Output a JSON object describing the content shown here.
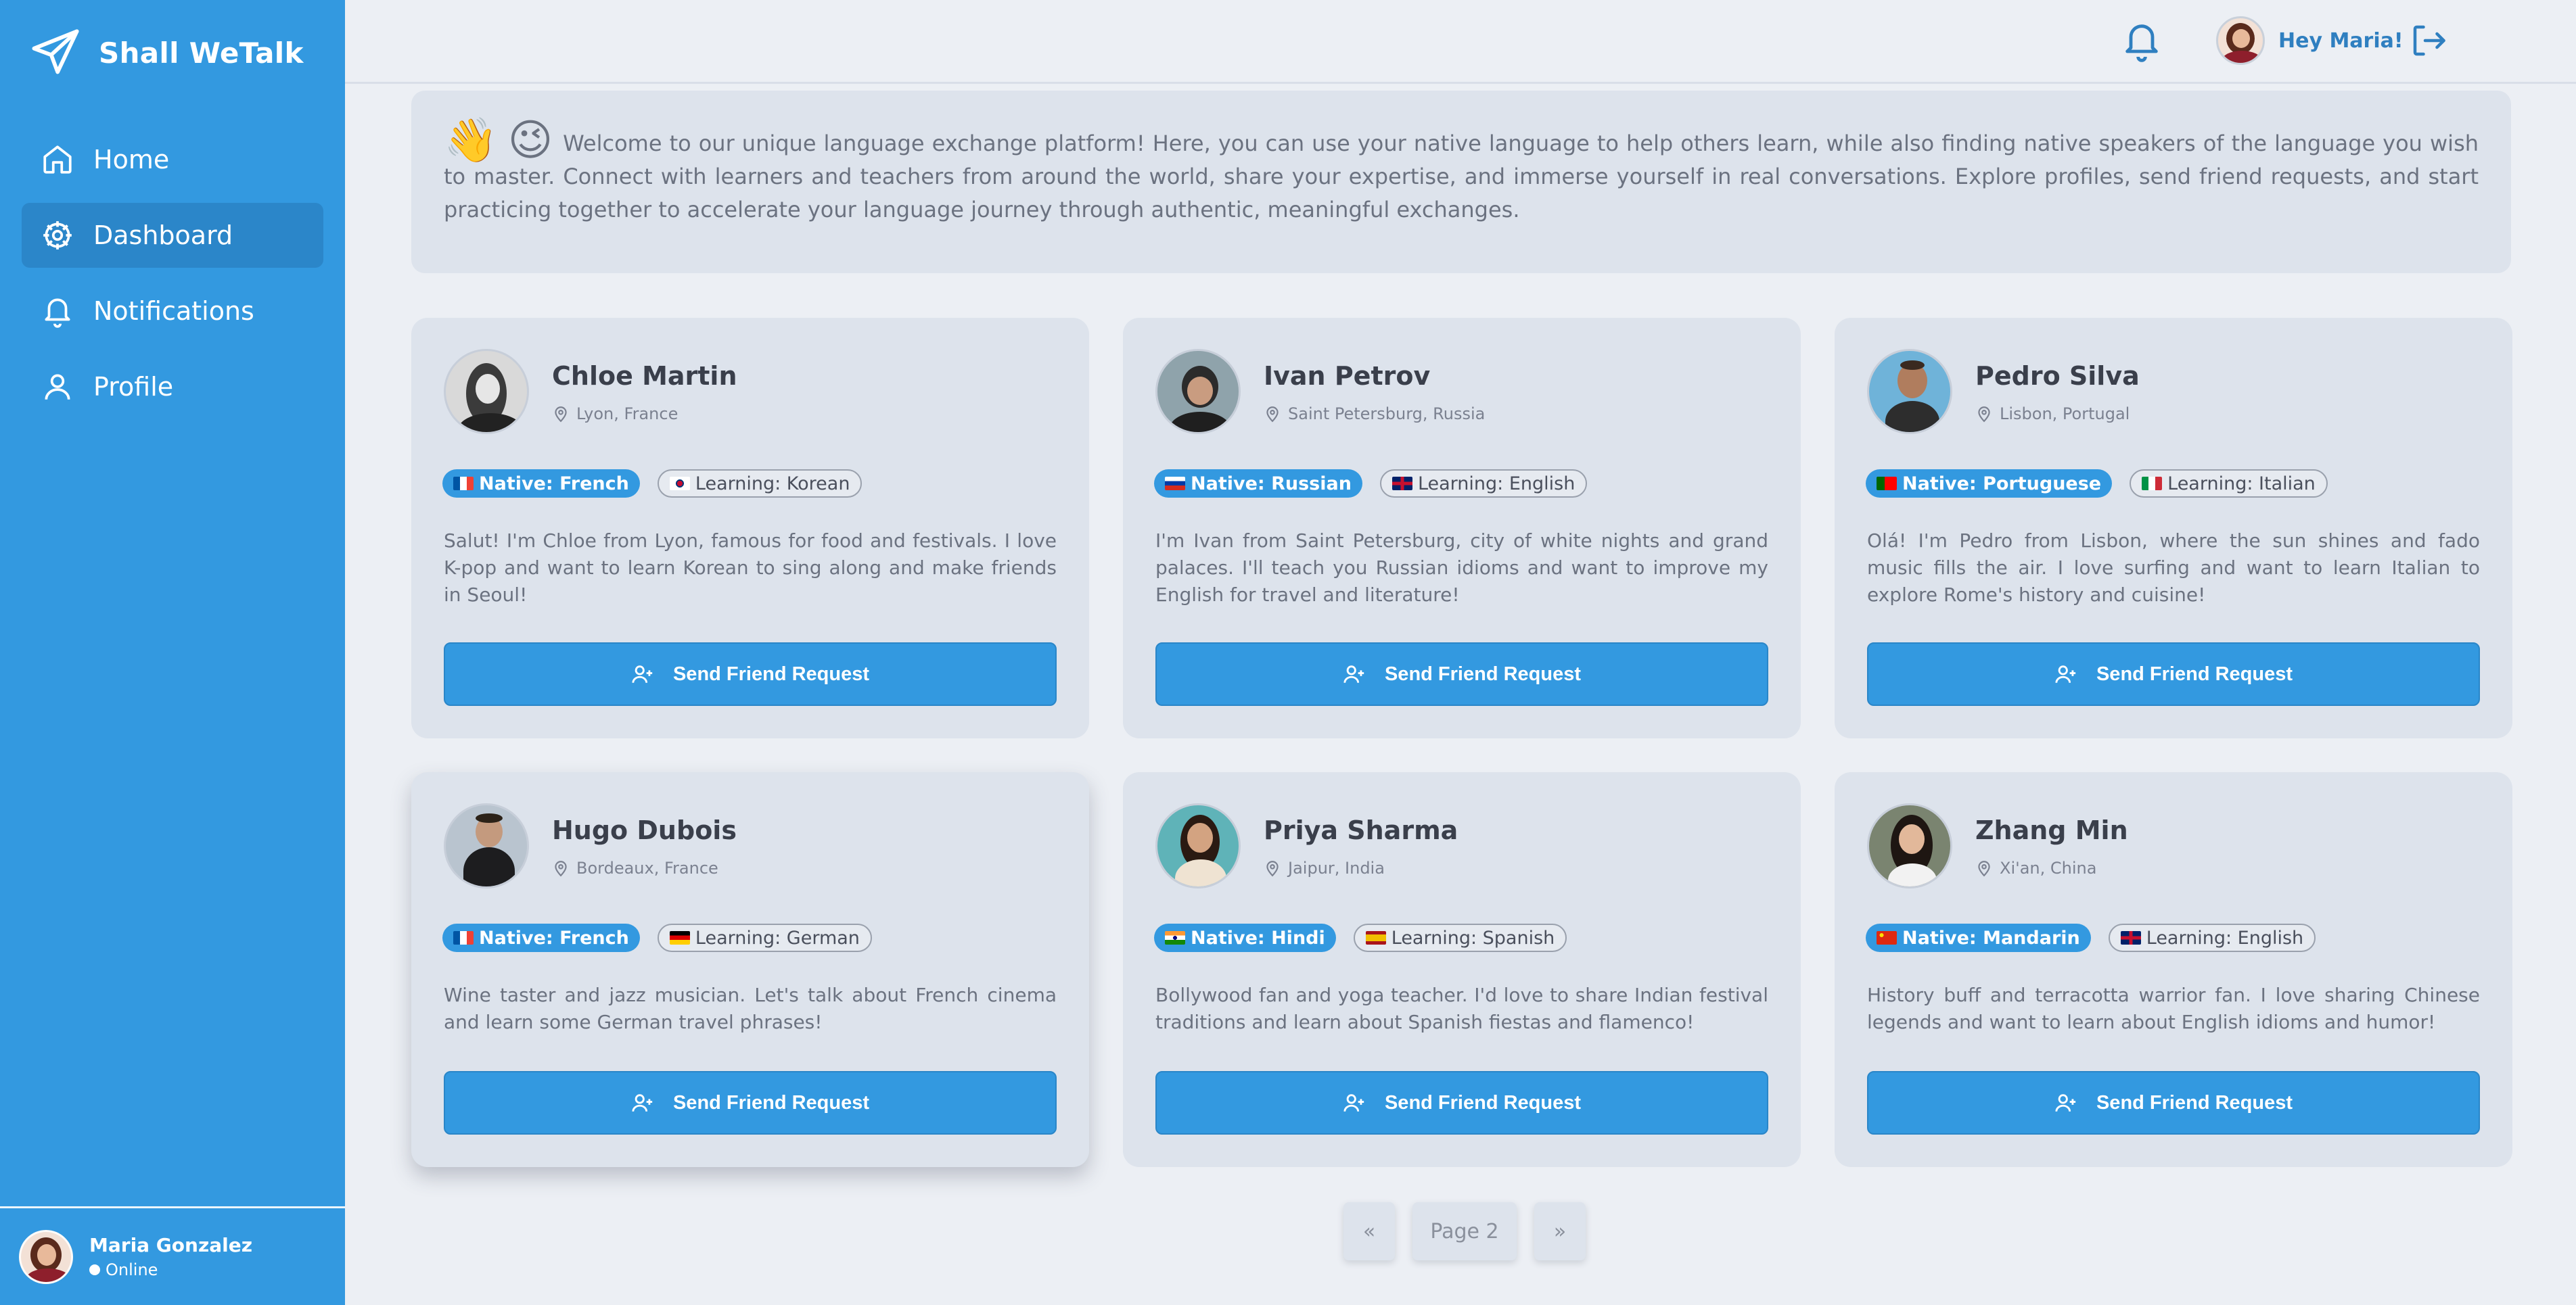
{
  "app": {
    "name": "Shall WeTalk"
  },
  "nav": [
    {
      "label": "Home",
      "icon": "home-icon"
    },
    {
      "label": "Dashboard",
      "icon": "dashboard-icon",
      "active": true
    },
    {
      "label": "Notifications",
      "icon": "bell-icon"
    },
    {
      "label": "Profile",
      "icon": "user-icon"
    }
  ],
  "sidebar_user": {
    "name": "Maria Gonzalez",
    "status": "Online"
  },
  "topbar": {
    "greeting": "Hey Maria!",
    "icons": [
      "bell-icon",
      "logout-icon"
    ]
  },
  "welcome": {
    "emojis": [
      "👋",
      "😉"
    ],
    "text": "Welcome to our unique language exchange platform! Here, you can use your native language to help others learn, while also finding native speakers of the language you wish to master. Connect with learners and teachers from around the world, share your expertise, and immerse yourself in real conversations. Explore profiles, send friend requests, and start practicing together to accelerate your language journey through authentic, meaningful exchanges."
  },
  "cards": [
    {
      "name": "Chloe Martin",
      "location": "Lyon, France",
      "native": "Native: French",
      "learning": "Learning: Korean",
      "bio": "Salut! I'm Chloe from Lyon, famous for food and festivals. I love K-pop and want to learn Korean to sing along and make friends in Seoul!",
      "button": "Send Friend Request"
    },
    {
      "name": "Ivan Petrov",
      "location": "Saint Petersburg, Russia",
      "native": "Native: Russian",
      "learning": "Learning: English",
      "bio": "I'm Ivan from Saint Petersburg, city of white nights and grand palaces. I'll teach you Russian idioms and want to improve my English for travel and literature!",
      "button": "Send Friend Request"
    },
    {
      "name": "Pedro Silva",
      "location": "Lisbon, Portugal",
      "native": "Native: Portuguese",
      "learning": "Learning: Italian",
      "bio": "Olá! I'm Pedro from Lisbon, where the sun shines and fado music fills the air. I love surfing and want to learn Italian to explore Rome's history and cuisine!",
      "button": "Send Friend Request"
    },
    {
      "name": "Hugo Dubois",
      "location": "Bordeaux, France",
      "native": "Native: French",
      "learning": "Learning: German",
      "bio": "Wine taster and jazz musician. Let's talk about French cinema and learn some German travel phrases!",
      "button": "Send Friend Request"
    },
    {
      "name": "Priya Sharma",
      "location": "Jaipur, India",
      "native": "Native: Hindi",
      "learning": "Learning: Spanish",
      "bio": "Bollywood fan and yoga teacher. I'd love to share Indian festival traditions and learn about Spanish fiestas and flamenco!",
      "button": "Send Friend Request"
    },
    {
      "name": "Zhang Min",
      "location": "Xi'an, China",
      "native": "Native: Mandarin",
      "learning": "Learning: English",
      "bio": "History buff and terracotta warrior fan. I love sharing Chinese legends and want to learn about English idioms and humor!",
      "button": "Send Friend Request"
    }
  ],
  "pagination": {
    "prev": "«",
    "page": "Page 2",
    "next": "»"
  },
  "colors": {
    "accent": "#3399e0",
    "card": "#dde3ec",
    "background": "#eceff4"
  }
}
